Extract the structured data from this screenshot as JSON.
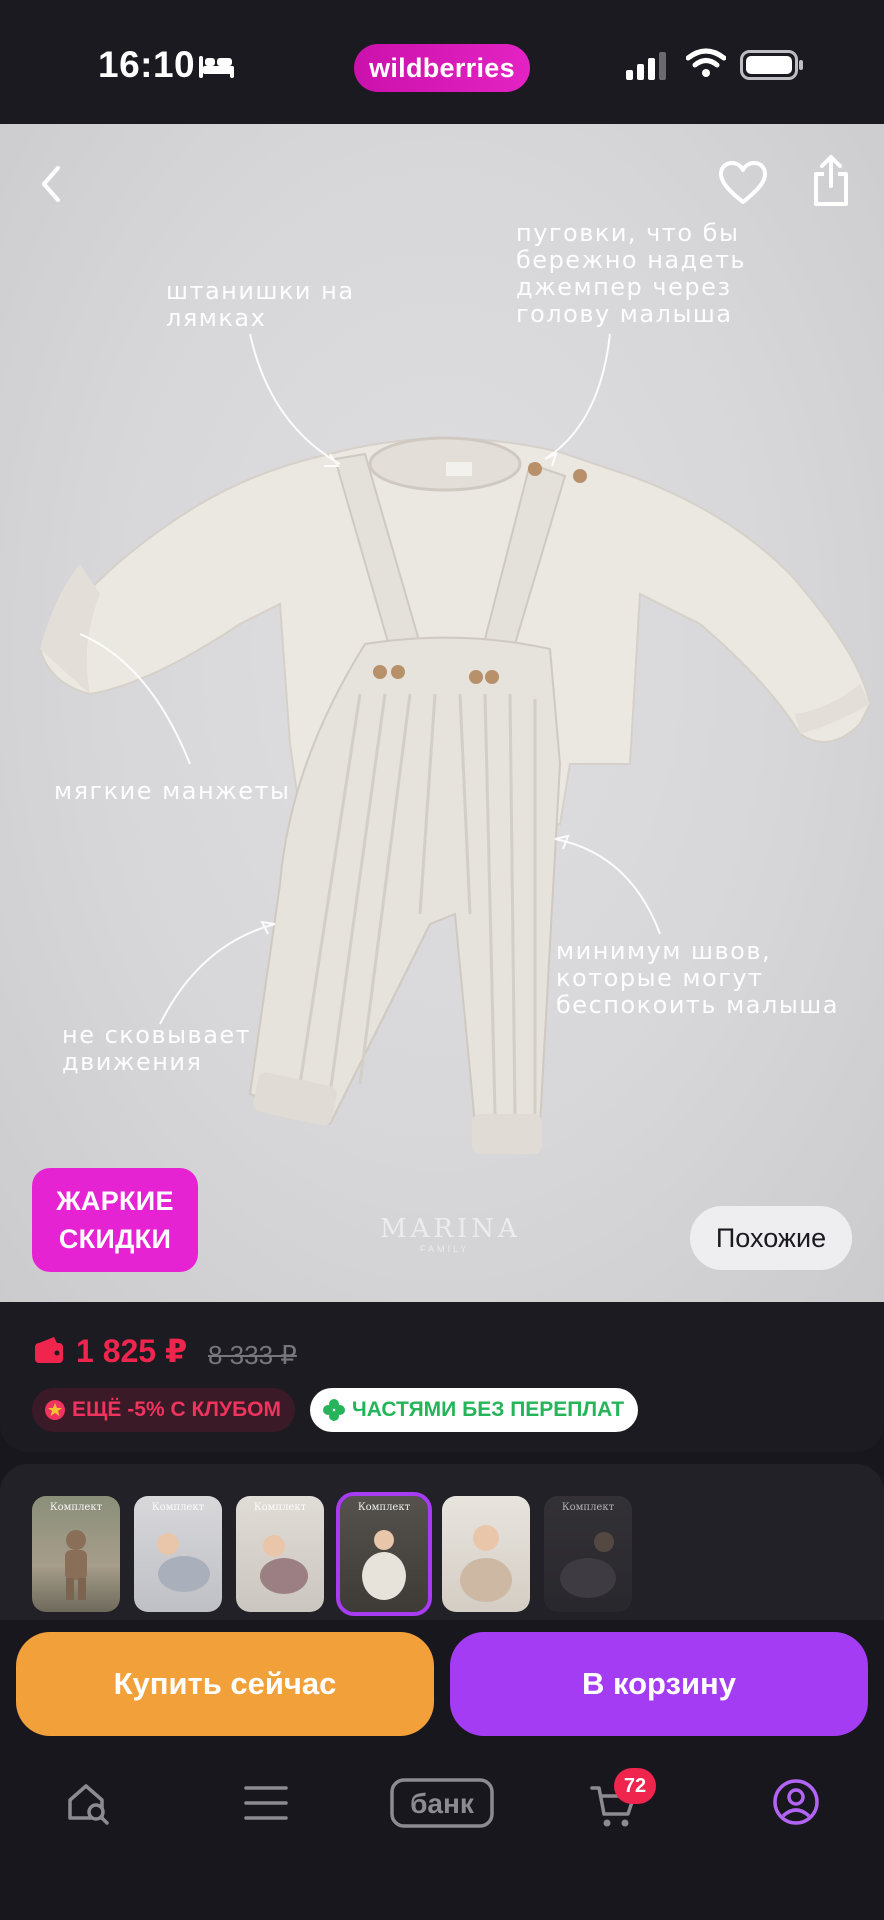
{
  "status_bar": {
    "time": "16:10",
    "brand": "wildberries"
  },
  "product": {
    "annotations": {
      "straps": "штанишки на\nлямках",
      "buttons": "пуговки, что бы\nбережно надеть\nджемпер через\nголову малыша",
      "cuffs": "мягкие манжеты",
      "movement": "не сковывает\nдвижения",
      "seams": "минимум швов,\nкоторые могут\nбеспокоить малыша"
    },
    "brand_mark": "MARINA",
    "brand_mark_sub": "FAMILY",
    "hot_badge_line1": "ЖАРКИЕ",
    "hot_badge_line2": "СКИДКИ",
    "similar_label": "Похожие",
    "price_current": "1 825 ₽",
    "price_old": "8 333 ₽",
    "club_chip": "ЕЩЁ -5% С КЛУБОМ",
    "installments_chip": "ЧАСТЯМИ БЕЗ ПЕРЕПЛАТ"
  },
  "thumbnails": [
    {
      "title": "Комплект"
    },
    {
      "title": "Комплект"
    },
    {
      "title": "Комплект"
    },
    {
      "title": "Комплект"
    },
    {
      "title": ""
    },
    {
      "title": "Комплект"
    }
  ],
  "actions": {
    "buy_now": "Купить сейчас",
    "add_to_cart": "В корзину"
  },
  "tabbar": {
    "bank_label": "банк",
    "cart_count": "72"
  },
  "colors": {
    "brand": "#cb11ab",
    "price": "#f0254e",
    "buy": "#f2a03a",
    "cart": "#a43cf3"
  }
}
